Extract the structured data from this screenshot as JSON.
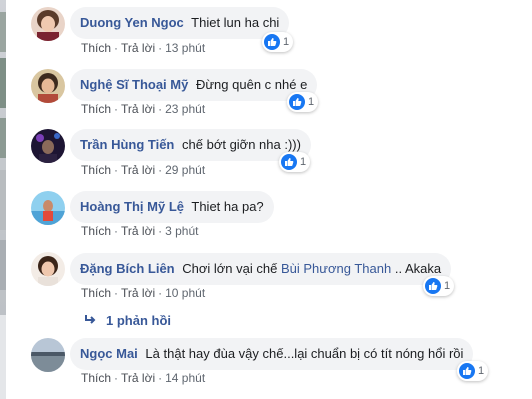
{
  "comments": [
    {
      "author": "Duong Yen Ngoc",
      "text": "Thiet lun ha chi",
      "like": "Thích",
      "reply": "Trả lời",
      "time": "13 phút",
      "reactions": "1"
    },
    {
      "author": "Nghệ Sĩ Thoại Mỹ",
      "text": "Đừng quên c nhé e",
      "like": "Thích",
      "reply": "Trả lời",
      "time": "23 phút",
      "reactions": "1"
    },
    {
      "author": "Trần Hùng Tiến",
      "text": "chế bớt giỡn nha :)))",
      "like": "Thích",
      "reply": "Trả lời",
      "time": "29 phút",
      "reactions": "1"
    },
    {
      "author": "Hoàng Thị Mỹ Lệ",
      "text": "Thiet ha pa?",
      "like": "Thích",
      "reply": "Trả lời",
      "time": "3 phút"
    },
    {
      "author": "Đặng Bích Liên",
      "text_before": "Chơi lớn vại chế",
      "mention": "Bùi Phương Thanh",
      "text_after": ".. Akaka",
      "like": "Thích",
      "reply": "Trả lời",
      "time": "10 phút",
      "reactions": "1"
    },
    {
      "author": "Ngọc Mai",
      "text": "Là thật hay đùa vậy chế...lại chuẩn bị có tít nóng hổi rồi",
      "like": "Thích",
      "reply": "Trả lời",
      "time": "14 phút",
      "reactions": "1"
    }
  ],
  "replies_link": "1 phản hồi",
  "separator": "·",
  "colors": {
    "name": "#385898",
    "bubble": "#f2f3f5",
    "like_badge": "#1877f2",
    "meta": "#606770"
  },
  "icons": {
    "reaction": "like-thumb-icon",
    "reply_arrow": "reply-arrow-icon"
  }
}
